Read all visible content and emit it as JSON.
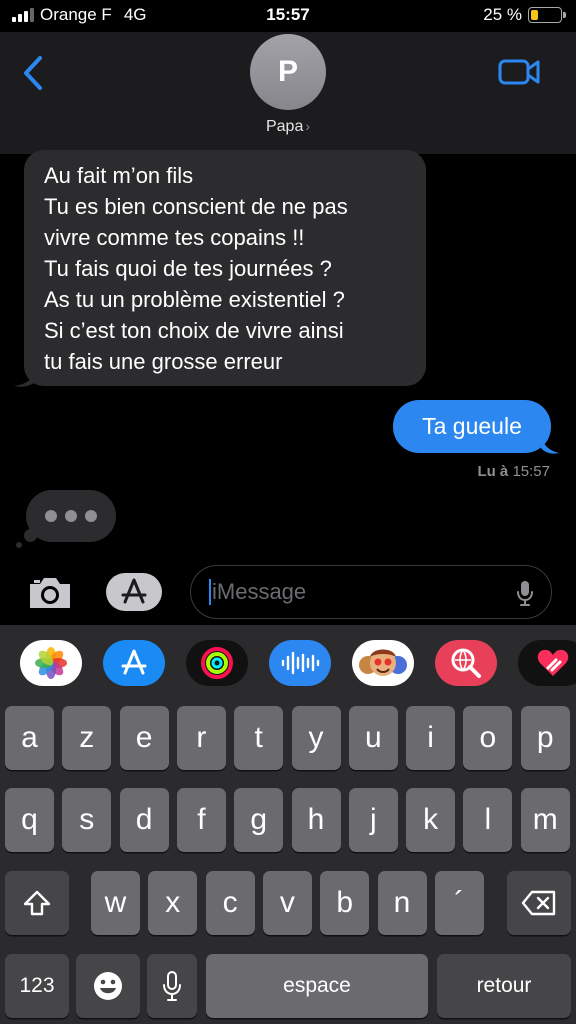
{
  "status_bar": {
    "carrier": "Orange F",
    "network": "4G",
    "time": "15:57",
    "battery_percent_label": "25 %",
    "battery_level": 0.25,
    "battery_color": "#f5c518"
  },
  "header": {
    "avatar_initial": "P",
    "contact_name": "Papa",
    "chevron": "›",
    "back_icon": "chevron-left-icon",
    "video_icon": "video-camera-icon",
    "accent_color": "#2c87f0"
  },
  "messages": {
    "incoming": [
      "Au fait m’on fils",
      "Tu es bien conscient de ne pas",
      "vivre comme tes copains !!",
      "Tu fais quoi de tes journées ?",
      "As tu un problème existentiel ?",
      "Si c’est ton choix de vivre ainsi",
      "tu fais une grosse erreur"
    ],
    "outgoing": "Ta gueule",
    "read_prefix": "Lu à",
    "read_time": "15:57"
  },
  "composer": {
    "placeholder": "iMessage",
    "camera_icon": "camera-icon",
    "apps_icon": "app-store-icon",
    "mic_icon": "microphone-icon"
  },
  "app_drawer": [
    "photos-icon",
    "app-store-icon",
    "activity-icon",
    "audio-message-icon",
    "memoji-icon",
    "web-search-icon",
    "digital-touch-icon"
  ],
  "keyboard": {
    "row1": [
      "a",
      "z",
      "e",
      "r",
      "t",
      "y",
      "u",
      "i",
      "o",
      "p"
    ],
    "row2": [
      "q",
      "s",
      "d",
      "f",
      "g",
      "h",
      "j",
      "k",
      "l",
      "m"
    ],
    "row3": [
      "w",
      "x",
      "c",
      "v",
      "b",
      "n",
      "´"
    ],
    "numbers_label": "123",
    "space_label": "espace",
    "return_label": "retour",
    "shift_icon": "shift-icon",
    "delete_icon": "backspace-icon",
    "emoji_icon": "emoji-icon",
    "dictation_icon": "microphone-icon"
  }
}
